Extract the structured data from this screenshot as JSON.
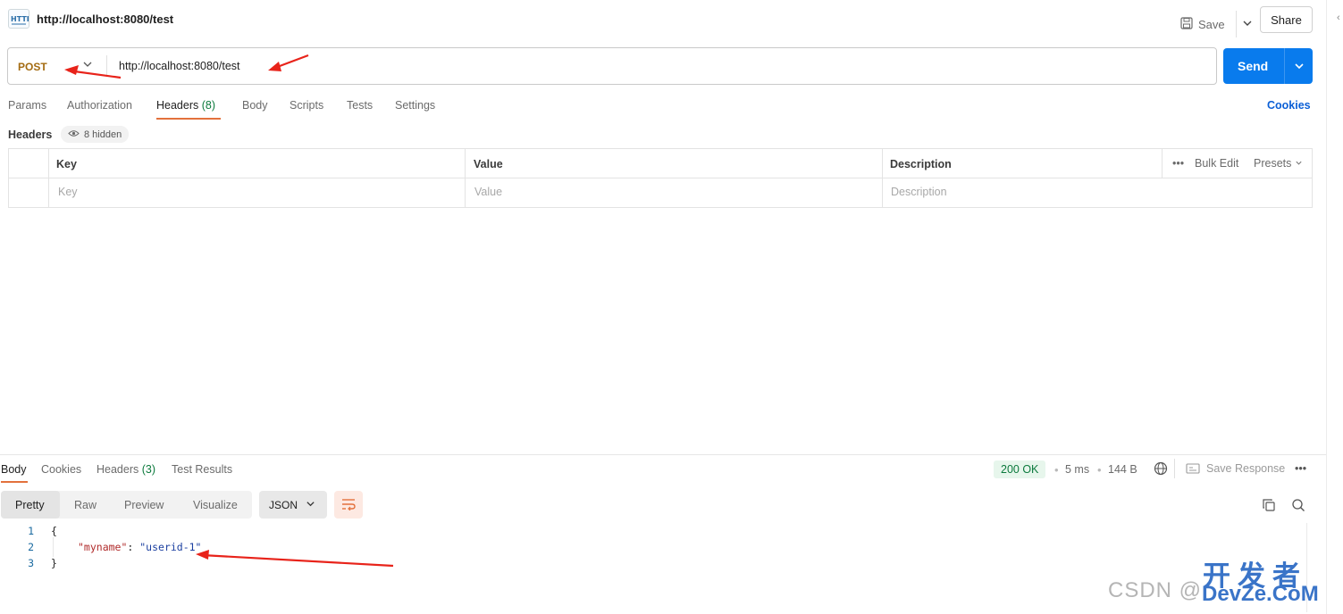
{
  "header": {
    "title": "http://localhost:8080/test",
    "save_label": "Save",
    "share_label": "Share"
  },
  "request": {
    "method": "POST",
    "url": "http://localhost:8080/test",
    "send_label": "Send"
  },
  "tabs": {
    "params": "Params",
    "authorization": "Authorization",
    "headers": "Headers",
    "headers_count": "(8)",
    "body": "Body",
    "scripts": "Scripts",
    "tests": "Tests",
    "settings": "Settings",
    "cookies": "Cookies"
  },
  "headers_section": {
    "label": "Headers",
    "hidden": "8 hidden",
    "columns": {
      "key": "Key",
      "value": "Value",
      "description": "Description"
    },
    "placeholders": {
      "key": "Key",
      "value": "Value",
      "description": "Description"
    },
    "bulk_edit": "Bulk Edit",
    "presets": "Presets"
  },
  "response": {
    "tabs": {
      "body": "Body",
      "cookies": "Cookies",
      "headers": "Headers",
      "headers_count": "(3)",
      "test_results": "Test Results"
    },
    "status": "200 OK",
    "time": "5 ms",
    "size": "144 B",
    "save_response": "Save Response",
    "formats": {
      "pretty": "Pretty",
      "raw": "Raw",
      "preview": "Preview",
      "visualize": "Visualize"
    },
    "language": "JSON",
    "code": {
      "line1_no": "1",
      "line2_no": "2",
      "line3_no": "3",
      "open_brace": "{",
      "key": "\"myname\"",
      "colon": ": ",
      "value": "\"userid-1\"",
      "close_brace": "}"
    }
  },
  "watermark": {
    "csdn": "CSDN @",
    "cn": "开发者",
    "site": "DevZe.CoM"
  },
  "colors": {
    "accent": "#e3713c",
    "send": "#097bed",
    "method": "#a46c12",
    "status_ok": "#0c7a3d",
    "annotation": "#e8231a"
  }
}
